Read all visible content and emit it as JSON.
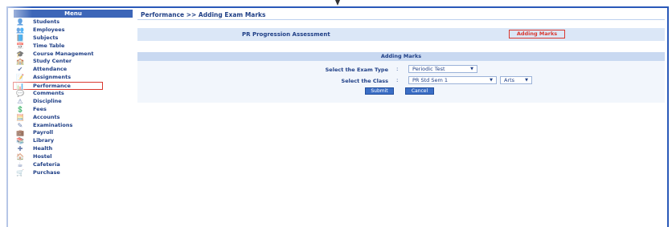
{
  "sidebar": {
    "header": "Menu",
    "items": [
      {
        "label": "Students",
        "icon": "student-icon"
      },
      {
        "label": "Employees",
        "icon": "employee-icon"
      },
      {
        "label": "Subjects",
        "icon": "book-icon"
      },
      {
        "label": "Time Table",
        "icon": "calendar-icon"
      },
      {
        "label": "Course Management",
        "icon": "course-icon"
      },
      {
        "label": "Study Center",
        "icon": "center-icon"
      },
      {
        "label": "Attendance",
        "icon": "attendance-icon"
      },
      {
        "label": "Assignments",
        "icon": "assignment-icon"
      },
      {
        "label": "Performance",
        "icon": "performance-icon"
      },
      {
        "label": "Comments",
        "icon": "comment-icon"
      },
      {
        "label": "Discipline",
        "icon": "discipline-icon"
      },
      {
        "label": "Fees",
        "icon": "fees-icon"
      },
      {
        "label": "Accounts",
        "icon": "accounts-icon"
      },
      {
        "label": "Examinations",
        "icon": "exam-icon"
      },
      {
        "label": "Payroll",
        "icon": "payroll-icon"
      },
      {
        "label": "Library",
        "icon": "library-icon"
      },
      {
        "label": "Health",
        "icon": "health-icon"
      },
      {
        "label": "Hostel",
        "icon": "hostel-icon"
      },
      {
        "label": "Cafeteria",
        "icon": "cafeteria-icon"
      },
      {
        "label": "Purchase",
        "icon": "purchase-icon"
      }
    ]
  },
  "main": {
    "title": "Performance >> Adding Exam Marks",
    "assessment_label": "PR Progression Assessment",
    "adding_marks_link": "Adding Marks",
    "panel_title": "Adding Marks",
    "exam_type": {
      "label": "Select the Exam Type",
      "colon": ":",
      "value": "Periodic Test"
    },
    "class": {
      "label": "Select the Class",
      "colon": ":",
      "value": "PR Std Sem 1",
      "section_value": "Arts"
    },
    "buttons": {
      "submit": "Submit",
      "cancel": "Cancel"
    }
  },
  "colors": {
    "accent": "#2a59b8",
    "highlight": "#d9382f",
    "panel_bg": "#dbe7f7"
  }
}
